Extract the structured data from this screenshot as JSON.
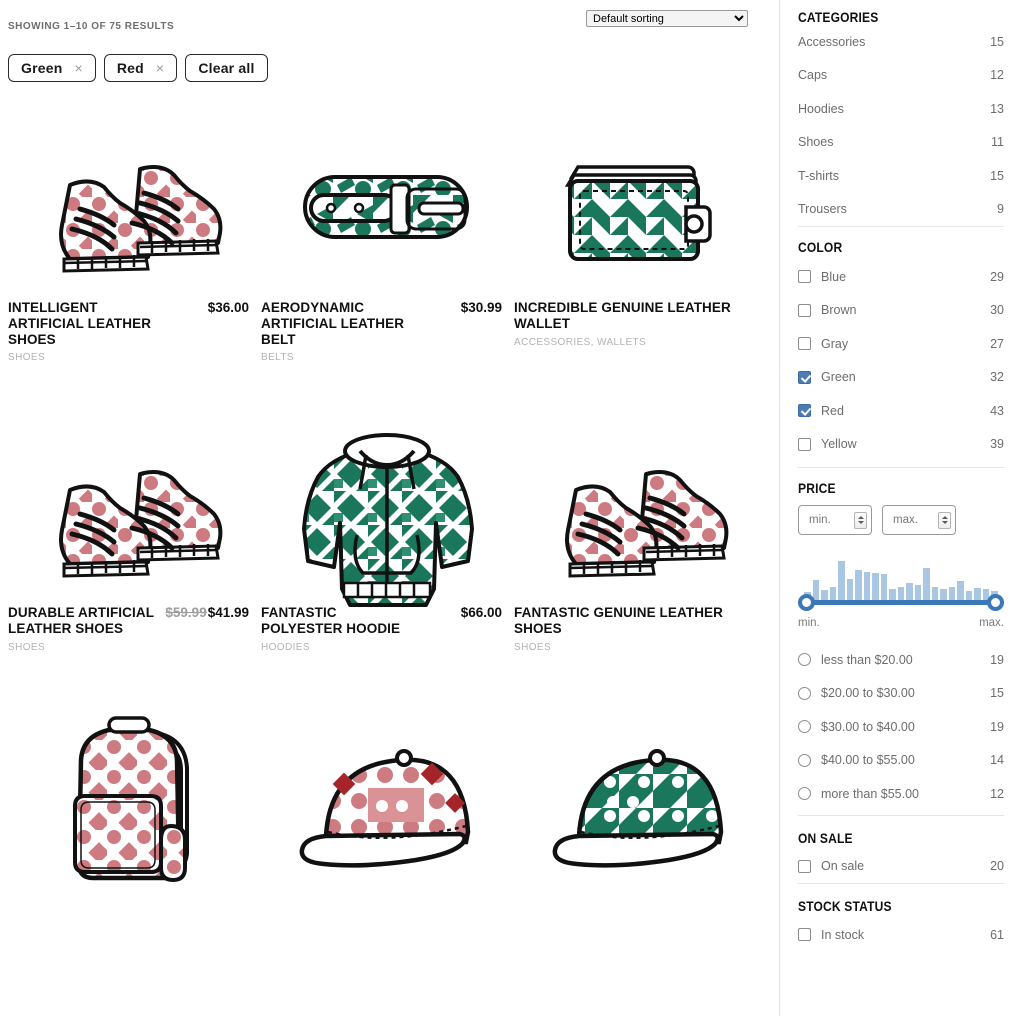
{
  "toolbar": {
    "results_text": "SHOWING 1–10 OF 75 RESULTS",
    "sort_selected": "Default sorting",
    "sort_options": [
      "Default sorting"
    ]
  },
  "active_filters": {
    "chips": [
      {
        "label": "Green",
        "remove_icon": "×"
      },
      {
        "label": "Red",
        "remove_icon": "×"
      }
    ],
    "clear_all_label": "Clear all"
  },
  "products": [
    {
      "title": "INTELLIGENT ARTIFICIAL LEATHER SHOES",
      "categories": "SHOES",
      "price": "$36.00",
      "old_price": "",
      "image": "shoes-red"
    },
    {
      "title": "AERODYNAMIC ARTIFICIAL LEATHER BELT",
      "categories": "BELTS",
      "price": "$30.99",
      "old_price": "",
      "image": "belt-green"
    },
    {
      "title": "INCREDIBLE GENUINE LEATHER WALLET",
      "categories": "ACCESSORIES, WALLETS",
      "price": "",
      "old_price": "",
      "image": "wallet-green"
    },
    {
      "title": "DURABLE ARTIFICIAL LEATHER SHOES",
      "categories": "SHOES",
      "price": "$41.99",
      "old_price": "$59.99",
      "image": "shoes-red"
    },
    {
      "title": "FANTASTIC POLYESTER HOODIE",
      "categories": "HOODIES",
      "price": "$66.00",
      "old_price": "",
      "image": "hoodie-green"
    },
    {
      "title": "FANTASTIC GENUINE LEATHER SHOES",
      "categories": "SHOES",
      "price": "",
      "old_price": "",
      "image": "shoes-red"
    },
    {
      "title": "",
      "categories": "",
      "price": "",
      "old_price": "",
      "image": "backpack-red"
    },
    {
      "title": "",
      "categories": "",
      "price": "",
      "old_price": "",
      "image": "cap-red"
    },
    {
      "title": "",
      "categories": "",
      "price": "",
      "old_price": "",
      "image": "cap-green"
    }
  ],
  "sidebar": {
    "categories": {
      "heading": "CATEGORIES",
      "items": [
        {
          "label": "Accessories",
          "count": "15"
        },
        {
          "label": "Caps",
          "count": "12"
        },
        {
          "label": "Hoodies",
          "count": "13"
        },
        {
          "label": "Shoes",
          "count": "11"
        },
        {
          "label": "T-shirts",
          "count": "15"
        },
        {
          "label": "Trousers",
          "count": "9"
        }
      ]
    },
    "color": {
      "heading": "COLOR",
      "items": [
        {
          "label": "Blue",
          "count": "29",
          "checked": false
        },
        {
          "label": "Brown",
          "count": "30",
          "checked": false
        },
        {
          "label": "Gray",
          "count": "27",
          "checked": false
        },
        {
          "label": "Green",
          "count": "32",
          "checked": true
        },
        {
          "label": "Red",
          "count": "43",
          "checked": true
        },
        {
          "label": "Yellow",
          "count": "39",
          "checked": false
        }
      ]
    },
    "price": {
      "heading": "PRICE",
      "min_placeholder": "min.",
      "max_placeholder": "max.",
      "min_value": "",
      "max_value": "",
      "slider_min_label": "min.",
      "slider_max_label": "max.",
      "histogram": [
        22,
        52,
        28,
        36,
        100,
        55,
        78,
        72,
        70,
        68,
        30,
        34,
        44,
        40,
        82,
        36,
        30,
        34,
        50,
        26,
        32,
        30,
        24
      ],
      "ranges": [
        {
          "label": "less than $20.00",
          "count": "19"
        },
        {
          "label": "$20.00 to $30.00",
          "count": "15"
        },
        {
          "label": "$30.00 to $40.00",
          "count": "19"
        },
        {
          "label": "$40.00 to $55.00",
          "count": "14"
        },
        {
          "label": "more than $55.00",
          "count": "12"
        }
      ]
    },
    "on_sale": {
      "heading": "ON SALE",
      "items": [
        {
          "label": "On sale",
          "count": "20",
          "checked": false
        }
      ]
    },
    "stock_status": {
      "heading": "STOCK STATUS",
      "items": [
        {
          "label": "In stock",
          "count": "61",
          "checked": false
        }
      ]
    }
  },
  "colors": {
    "green": "#1b775c",
    "red": "#cd7b80",
    "dark_red": "#a5242a",
    "accent_blue": "#4a7cb5",
    "slider_blue": "#3b78b8",
    "histogram_blue": "#a9c6e3",
    "text": "#1a1a1a",
    "muted": "#6d6d6d"
  }
}
